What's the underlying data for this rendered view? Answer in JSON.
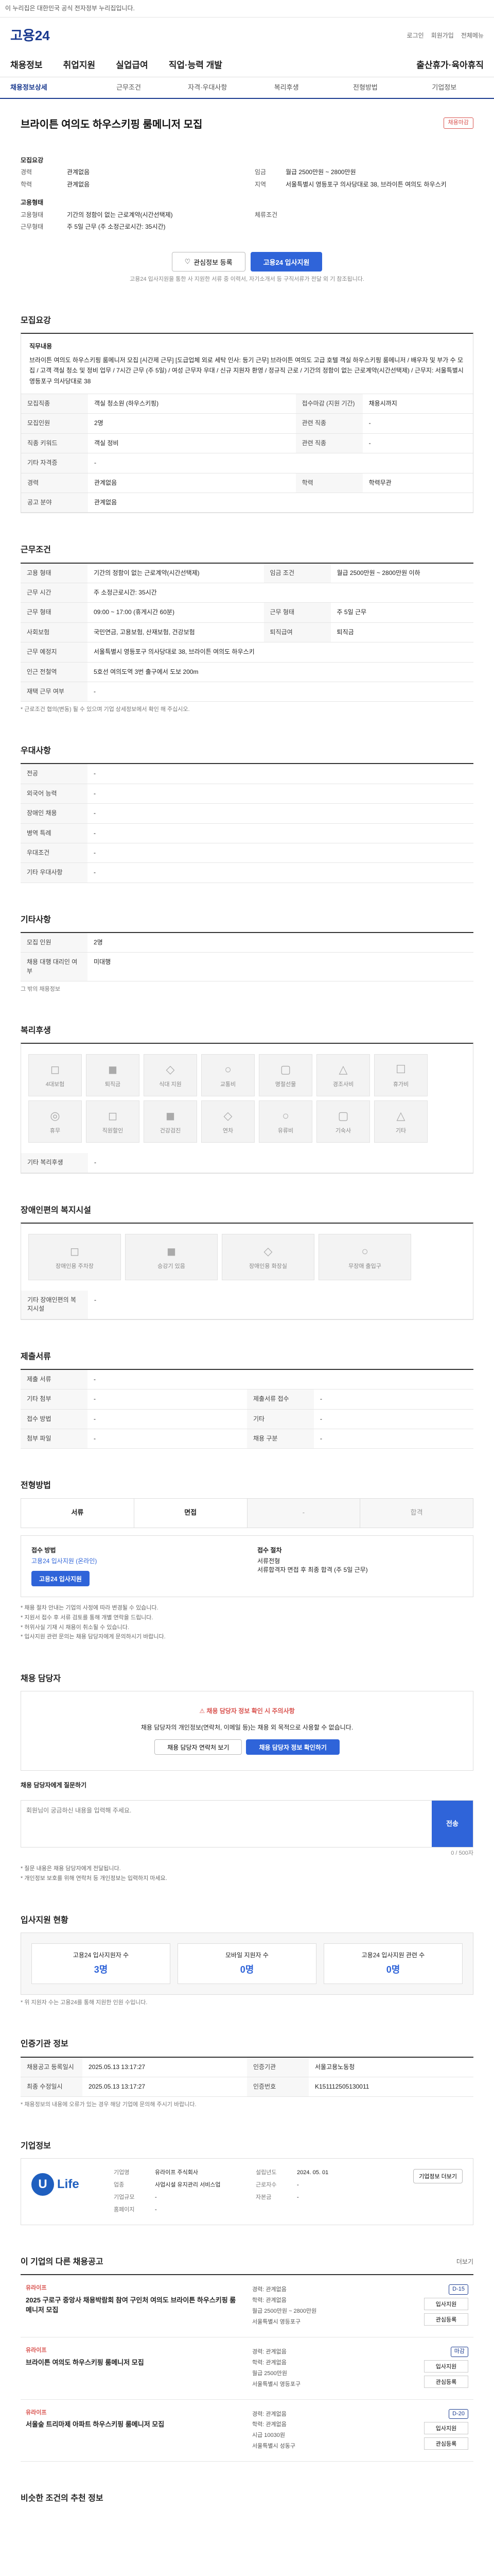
{
  "topbar": {
    "text": "이 누리집은 대한민국 공식 전자정부 누리집입니다."
  },
  "header": {
    "logo": "고용24",
    "links": [
      "로그인",
      "회원가입",
      "전체메뉴"
    ]
  },
  "mainnav": [
    "채용정보",
    "취업지원",
    "실업급여",
    "직업·능력 개발",
    "출산휴가·육아휴직"
  ],
  "subnav": [
    "채용정보상세",
    "근무조건",
    "자격·우대사항",
    "복리후생",
    "전형방법",
    "기업정보"
  ],
  "job": {
    "title": "브라이튼 여의도 하우스키핑 룸메니저 모집",
    "badge": "채용마감",
    "summary": [
      {
        "k": "경력",
        "v": "관계없음",
        "k2": "임금",
        "v2": "월급 2500만원 ~ 2800만원"
      },
      {
        "k": "학력",
        "v": "관계없음",
        "k2": "지역",
        "v2": "서울특별시 영등포구 의사당대로 38, 브라이튼 여의도 하우스키"
      }
    ],
    "sub1": "모집요강",
    "sub2": "고용형태",
    "summary2": [
      {
        "k": "고용형태",
        "v": "기간의 정함이 없는 근로계약(시간선택제)"
      },
      {
        "k": "근무형태",
        "v": "주 5일 근무 (주 소정근로시간: 35시간)"
      }
    ],
    "wage_label": "체류조건",
    "fav_label": "관심정보 등록",
    "apply_label": "고용24 입사지원",
    "notice": "고용24 입사지원을 통한 사 지원한 서류 중 이력서, 자기소개서 등 구직서류가 전달 외 기 참조됩니다."
  },
  "recruit": {
    "title": "모집요강",
    "intro_label": "직무내용",
    "intro": "브라이튼 여의도 하우스키핑 룸메니저 모집 [시간제 근무] [도급업체 외로 세탁 인사: 등기 근무]  브라이튼 여의도 고급 호텔 객실 하우스키핑 룸메니저 / 배우자 및 부가 수 모집 / 고객 객실 청소 및 정비 업무 / 7시간 근무 (주 5일) / 여성 근무자 우대 / 신규 지원자 환영 / 정규직 근로 / 기간의 정함이 없는 근로계약(시간선택제) / 근무지: 서울특별시 영등포구 의사당대로 38",
    "rows": [
      {
        "k": "모집직종",
        "v": "객실 청소원 (하우스키핑)",
        "k2": "접수마감 (지원 기간)",
        "v2": "채용시까지"
      },
      {
        "k": "모집인원",
        "v": "2명",
        "k2": "관련 직종",
        "v2": "-"
      },
      {
        "k": "직종 키워드",
        "v": "객실 정비",
        "k2": "관련 직종",
        "v2": "-"
      },
      {
        "k": "기타 자격증",
        "v": "-",
        "k2": "",
        "v2": ""
      },
      {
        "k": "경력",
        "v": "관계없음",
        "k2": "학력",
        "v2": "학력무관"
      },
      {
        "k": "공고 분야",
        "v": "관계없음",
        "k2": "",
        "v2": ""
      }
    ]
  },
  "conditions": {
    "title": "근무조건",
    "rows": [
      {
        "k": "고용 형태",
        "v": "기간의 정함이 없는 근로계약(시간선택제)",
        "k2": "임금 조건",
        "v2": "월급 2500만원 ~ 2800만원 이하"
      },
      {
        "k": "근무 시간",
        "v": "주 소정근로시간: 35시간",
        "k2": "",
        "v2": ""
      },
      {
        "k": "근무 형태",
        "v": "09:00 ~ 17:00 (휴게시간 60분)",
        "k2": "근무 형태",
        "v2": "주 5일 근무"
      },
      {
        "k": "사회보험",
        "v": "국민연금, 고용보험, 산재보험, 건강보험",
        "k2": "퇴직급여",
        "v2": "퇴직금"
      },
      {
        "k": "근무 예정지",
        "v": "서울특별시 영등포구 의사당대로 38, 브라이튼 여의도 하우스키",
        "k2": "",
        "v2": ""
      },
      {
        "k": "인근 전철역",
        "v": "5호선 여의도역 3번 출구에서 도보 200m",
        "k2": "",
        "v2": ""
      },
      {
        "k": "재택 근무 여부",
        "v": "-",
        "k2": "",
        "v2": ""
      }
    ],
    "pill": "지도 보기",
    "sub_note": "주 소정근로시간 35시간",
    "link": "근로시간 안내",
    "footnote": "* 근로조건 협의(변동) 될 수 있으며 기업 상세정보에서 확인 해 주십시오."
  },
  "prefer": {
    "title": "우대사항",
    "rows": [
      {
        "k": "전공",
        "v": "-"
      },
      {
        "k": "외국어 능력",
        "v": "-"
      },
      {
        "k": "장애인 채용",
        "v": "-"
      },
      {
        "k": "병역 특례",
        "v": "-"
      },
      {
        "k": "우대조건",
        "v": "-"
      },
      {
        "k": "기타 우대사항",
        "v": "-"
      }
    ]
  },
  "etc": {
    "title": "기타사항",
    "rows": [
      {
        "k": "모집 인원",
        "v": "2명"
      },
      {
        "k": "채용 대행 대리인 여부",
        "v": "미대행"
      }
    ],
    "note": "그 밖의 채용정보"
  },
  "welfare": {
    "title": "복리후생",
    "cards": [
      "4대보험",
      "퇴직금",
      "식대 지원",
      "교통비",
      "명절선물",
      "경조사비",
      "휴가비",
      "휴무",
      "직원할인",
      "건강검진",
      "연차",
      "유류비",
      "기숙사",
      "기타"
    ],
    "etc_label": "기타 복리후생",
    "etc_value": "-"
  },
  "disabled": {
    "title": "장애인편의 복지시설",
    "cards": [
      "장애인용 주차장",
      "승강기 있음",
      "장애인용 화장실",
      "무장애 출입구"
    ],
    "etc_label": "기타 장애인편의 복지시설",
    "etc_value": "-"
  },
  "screening": {
    "title": "제출서류",
    "rows": [
      {
        "k": "제출 서류",
        "v": "-",
        "k2": "",
        "v2": ""
      },
      {
        "k": "기타 첨부",
        "v": "-",
        "k2": "제출서류 접수",
        "v2": "-"
      },
      {
        "k": "접수 방법",
        "v": "-",
        "k2": "기타",
        "v2": "-"
      },
      {
        "k": "첨부 파일",
        "v": "-",
        "k2": "채용 구분",
        "v2": "-"
      }
    ]
  },
  "method": {
    "title": "전형방법",
    "items": [
      "서류",
      "면접",
      "-",
      "합격"
    ],
    "apply_label": "접수 방법",
    "apply_how": "고용24 입사지원 (온라인)",
    "apply_btn": "고용24 입사지원",
    "step_label": "접수 절차",
    "step_value": "서류전형",
    "step_detail": "서류합격자 면접 후 최종 합격 (주 5일 근무)",
    "notes": [
      "* 채용 절차 안내는 기업의 사정에 따라 변경될 수 있습니다.",
      "* 지원서 접수 후 서류 검토를 통해 개별 연락을 드립니다.",
      "* 허위사실 기재 시 채용이 취소될 수 있습니다.",
      "* 입사지원 관련 문의는 채용 담당자에게 문의하시기 바랍니다."
    ]
  },
  "manager": {
    "title": "채용 담당자",
    "warn": "채용 담당자 정보 확인 시 주의사항",
    "desc": "채용 담당자의 개인정보(연락처, 이메일 등)는 채용 외 목적으로 사용할 수 없습니다.",
    "btn1": "채용 담당자 연락처 보기",
    "btn2": "채용 담당자 정보 확인하기",
    "qa_label": "채용 담당자에게 질문하기",
    "qa_placeholder": "회원님이 궁금하신 내용을 입력해 주세요.",
    "qa_count": "0 / 500자",
    "qa_send": "전송",
    "qa_notes": [
      "* 질문 내용은 채용 담당자에게 전달됩니다.",
      "* 개인정보 보호를 위해 연락처 등 개인정보는 입력하지 마세요."
    ]
  },
  "stats": {
    "title": "입사지원 현황",
    "items": [
      {
        "label": "고용24 입사지원자 수",
        "value": "3명"
      },
      {
        "label": "모바일 지원자 수",
        "value": "0명"
      },
      {
        "label": "고용24 입사지원 관련 수",
        "value": "0명"
      }
    ],
    "note": "* 위 지원자 수는 고용24를 통해 지원한 인원 수입니다."
  },
  "info": {
    "title": "인증기관 정보",
    "rows": [
      {
        "k": "채용공고 등록일시",
        "v": "2025.05.13 13:17:27",
        "k2": "인증기관",
        "v2": "서울고용노동청"
      },
      {
        "k": "최종 수정일시",
        "v": "2025.05.13 13:17:27",
        "k2": "인증번호",
        "v2": "K151112505130011"
      }
    ],
    "note": "* 채용정보의 내용에 오류가 있는 경우 해당 기업에 문의해 주시기 바랍니다."
  },
  "company": {
    "title": "기업정보",
    "logo_letter": "U",
    "logo_text": "Life",
    "rows": [
      {
        "k": "기업명",
        "v": "유라이프 주식회사",
        "k2": "설립년도",
        "v2": "2024. 05. 01"
      },
      {
        "k": "업종",
        "v": "사업시설 유지관리 서비스업",
        "k2": "근로자수",
        "v2": "-"
      },
      {
        "k": "기업규모",
        "v": "-",
        "k2": "자본금",
        "v2": "-"
      },
      {
        "k": "홈페이지",
        "v": "-",
        "k2": "",
        "v2": ""
      }
    ],
    "btn": "기업정보 더보기"
  },
  "others": {
    "title": "이 기업의 다른 채용공고",
    "more": "더보기",
    "items": [
      {
        "company": "유라이프",
        "title": "2025 구로구 중앙사 채용박람회 참여 구인처 여의도 브라이튼 하우스키핑 룸메니저 모집",
        "meta": [
          "경력: 관계없음",
          "학력: 관계없음",
          "월급 2500만원 ~ 2800만원",
          "서울특별시 영등포구"
        ],
        "tag": "D-15"
      },
      {
        "company": "유라이프",
        "title": "브라이튼 여의도 하우스키핑 룸메니저 모집",
        "meta": [
          "경력: 관계없음",
          "학력: 관계없음",
          "월급 2500만원",
          "서울특별시 영등포구"
        ],
        "tag": "마감"
      },
      {
        "company": "유라이프",
        "title": "서울숲 트리마제 아파트 하우스키핑 룸메니저 모집",
        "meta": [
          "경력: 관계없음",
          "학력: 관계없음",
          "시급 10030원",
          "서울특별시 성동구"
        ],
        "tag": "D-20"
      }
    ],
    "btn1": "입사지원",
    "btn2": "관심등록"
  },
  "bottom_title": "비슷한 조건의 추천 정보"
}
